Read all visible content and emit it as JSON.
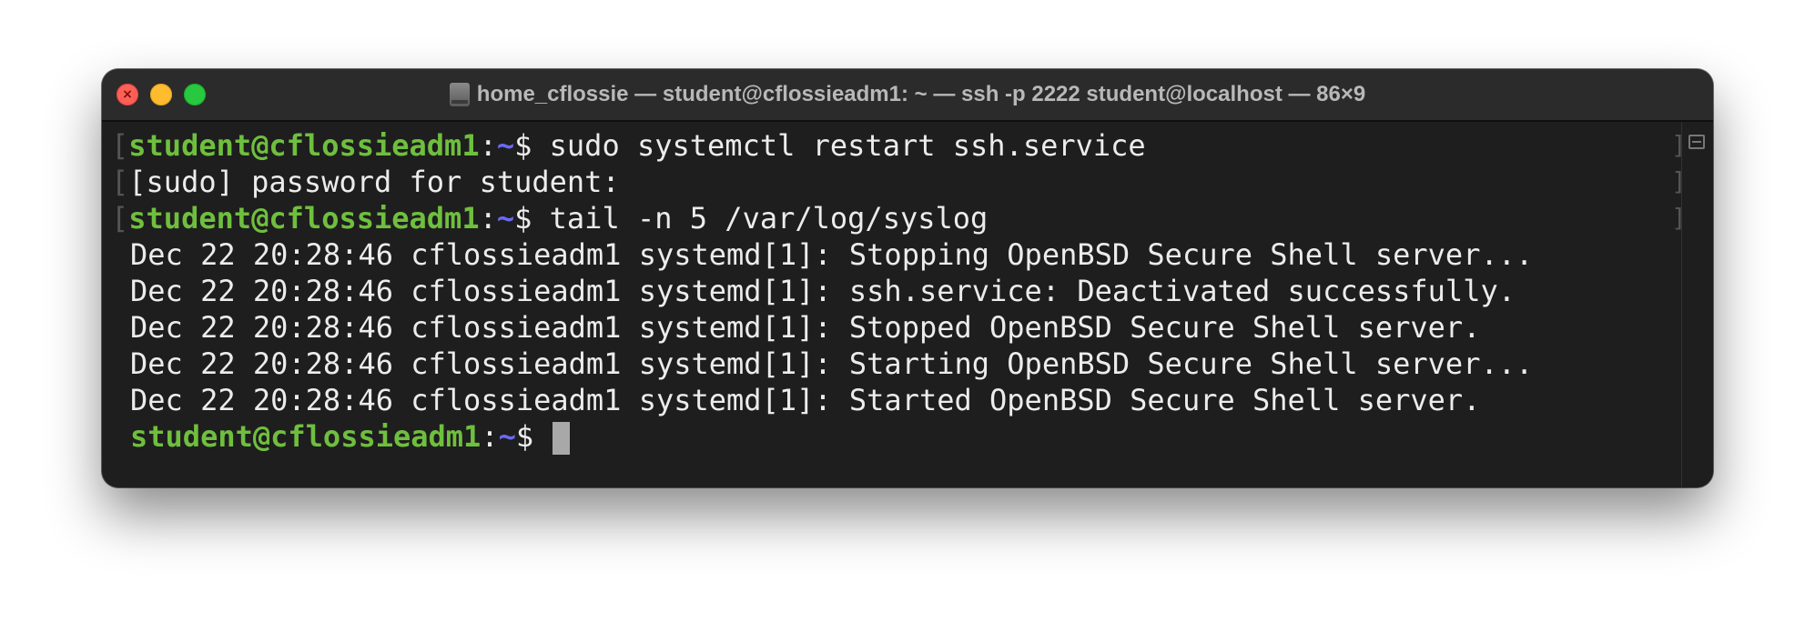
{
  "window": {
    "title": "home_cflossie — student@cflossieadm1: ~ — ssh -p 2222 student@localhost — 86×9",
    "icon": "disk-icon"
  },
  "terminal": {
    "prompt_user": "student@cflossieadm1",
    "prompt_colon": ":",
    "prompt_path": "~",
    "prompt_suffix": "$ ",
    "lines": [
      {
        "type": "prompt",
        "command": "sudo systemctl restart ssh.service"
      },
      {
        "type": "output",
        "text": "[sudo] password for student:"
      },
      {
        "type": "prompt",
        "command": "tail -n 5 /var/log/syslog"
      },
      {
        "type": "output",
        "text": "Dec 22 20:28:46 cflossieadm1 systemd[1]: Stopping OpenBSD Secure Shell server..."
      },
      {
        "type": "output",
        "text": "Dec 22 20:28:46 cflossieadm1 systemd[1]: ssh.service: Deactivated successfully."
      },
      {
        "type": "output",
        "text": "Dec 22 20:28:46 cflossieadm1 systemd[1]: Stopped OpenBSD Secure Shell server."
      },
      {
        "type": "output",
        "text": "Dec 22 20:28:46 cflossieadm1 systemd[1]: Starting OpenBSD Secure Shell server..."
      },
      {
        "type": "output",
        "text": "Dec 22 20:28:46 cflossieadm1 systemd[1]: Started OpenBSD Secure Shell server."
      },
      {
        "type": "prompt",
        "command": ""
      }
    ]
  },
  "colors": {
    "prompt_user": "#6fbf3e",
    "prompt_path": "#6a6af5",
    "text": "#ececec",
    "background": "#1e1e1e"
  }
}
